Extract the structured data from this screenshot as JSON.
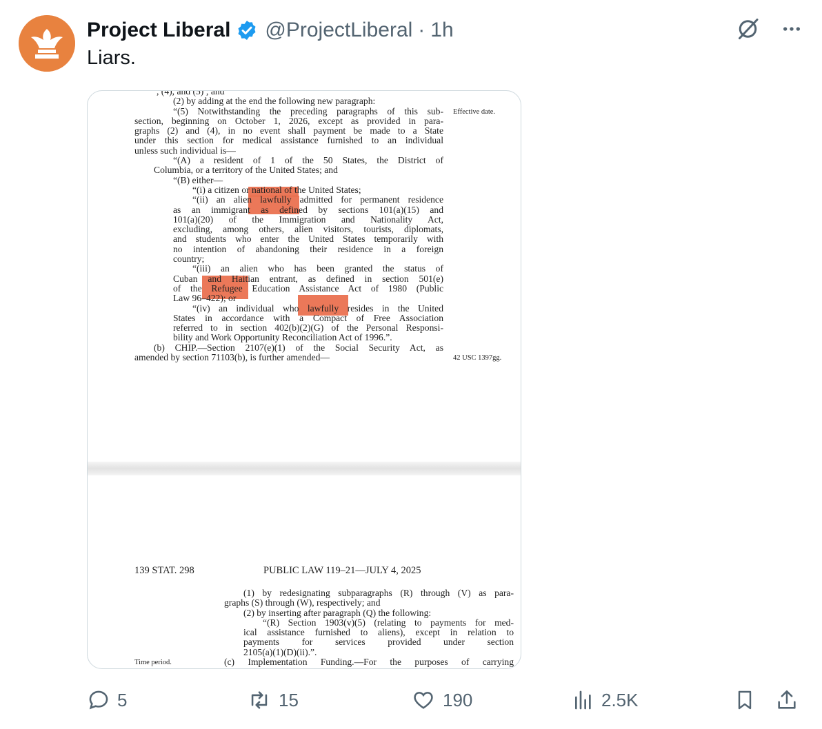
{
  "author": {
    "name": "Project Liberal",
    "handle": "@ProjectLiberal",
    "separator": "·",
    "time": "1h",
    "avatar_icon": "phoenix-logo-icon",
    "brand_color": "#e8823f",
    "verified_color": "#1d9bf0"
  },
  "tweet": {
    "text": "Liars."
  },
  "top_icons": [
    "grok-icon",
    "more-icon"
  ],
  "doc_top": {
    "cut_line": ", (4), and (5) ; and",
    "lines": [
      {
        "t": "(2) by adding at the end the following new paragraph:",
        "i": 56
      },
      {
        "t": "“(5) Notwithstanding the preceding paragraphs of this sub-",
        "i": 56,
        "j": true
      },
      {
        "t": "section, beginning on October 1, 2026, except as provided in para-",
        "i": 0,
        "j": true
      },
      {
        "t": "graphs (2) and (4), in no event shall payment be made to a State",
        "i": 0,
        "j": true
      },
      {
        "t": "under this section for medical assistance furnished to an individual",
        "i": 0,
        "j": true
      },
      {
        "t": "unless such individual is—",
        "i": 0
      },
      {
        "t": "“(A) a resident of 1 of the 50 States, the District of",
        "i": 56,
        "j": true
      },
      {
        "t": "Columbia, or a territory of the United States; and",
        "i": 28
      },
      {
        "t": "“(B) either—",
        "i": 56
      },
      {
        "t": "“(i) a citizen or national of the United States;",
        "i": 84
      },
      {
        "t": "“(ii) an alien lawfully admitted for permanent residence",
        "i": 84,
        "j": true
      },
      {
        "t": "as an immigrant as defined by sections 101(a)(15) and",
        "i": 56,
        "j": true
      },
      {
        "t": "101(a)(20) of the Immigration and Nationality Act,",
        "i": 56,
        "j": true
      },
      {
        "t": "excluding, among others, alien visitors, tourists, diplomats,",
        "i": 56,
        "j": true
      },
      {
        "t": "and students who enter the United States temporarily with",
        "i": 56,
        "j": true
      },
      {
        "t": "no intention of abandoning their residence in a foreign",
        "i": 56,
        "j": true
      },
      {
        "t": "country;",
        "i": 56
      },
      {
        "t": "“(iii) an alien who has been granted the status of",
        "i": 84,
        "j": true
      },
      {
        "t": "Cuban and Haitian entrant, as defined in section 501(e)",
        "i": 56,
        "j": true
      },
      {
        "t": "of the Refugee Education Assistance Act of 1980 (Public",
        "i": 56,
        "j": true
      },
      {
        "t": "Law 96–422); or",
        "i": 56
      },
      {
        "t": "“(iv) an individual who lawfully resides in the United",
        "i": 84,
        "j": true
      },
      {
        "t": "States in accordance with a Compact of Free Association",
        "i": 56,
        "j": true
      },
      {
        "t": "referred to in section 402(b)(2)(G) of the Personal Responsi-",
        "i": 56,
        "j": true
      },
      {
        "t": "bility and Work Opportunity Reconciliation Act of 1996.”.",
        "i": 56
      },
      {
        "t": "(b) CHIP.—Section 2107(e)(1) of the Social Security Act, as",
        "i": 28,
        "j": true
      },
      {
        "t": "amended by section 71103(b), is further amended—",
        "i": 0
      }
    ],
    "margin_effective": "Effective date.",
    "margin_usc": "42 USC 1397gg."
  },
  "doc_bottom": {
    "stat": "139 STAT. 298",
    "law": "PUBLIC LAW 119–21—JULY 4, 2025",
    "lines": [
      {
        "t": "(1) by redesignating subparagraphs (R) through (V) as para-",
        "i": 28,
        "j": true
      },
      {
        "t": "graphs (S) through (W), respectively; and",
        "i": 0
      },
      {
        "t": "(2) by inserting after paragraph (Q) the following:",
        "i": 28
      },
      {
        "t": "“(R) Section 1903(v)(5) (relating to payments for med-",
        "i": 56,
        "j": true
      },
      {
        "t": "ical assistance furnished to aliens), except in relation to",
        "i": 28,
        "j": true
      },
      {
        "t": "payments for services provided under section",
        "i": 28,
        "j": true
      },
      {
        "t": "2105(a)(1)(D)(ii).”.",
        "i": 28
      },
      {
        "t": "(c) Implementation Funding.—For the purposes of carrying",
        "i": 0,
        "j": true
      }
    ],
    "margin_time": "Time period."
  },
  "actions": {
    "replies": "5",
    "reposts": "15",
    "likes": "190",
    "views": "2.5K"
  }
}
